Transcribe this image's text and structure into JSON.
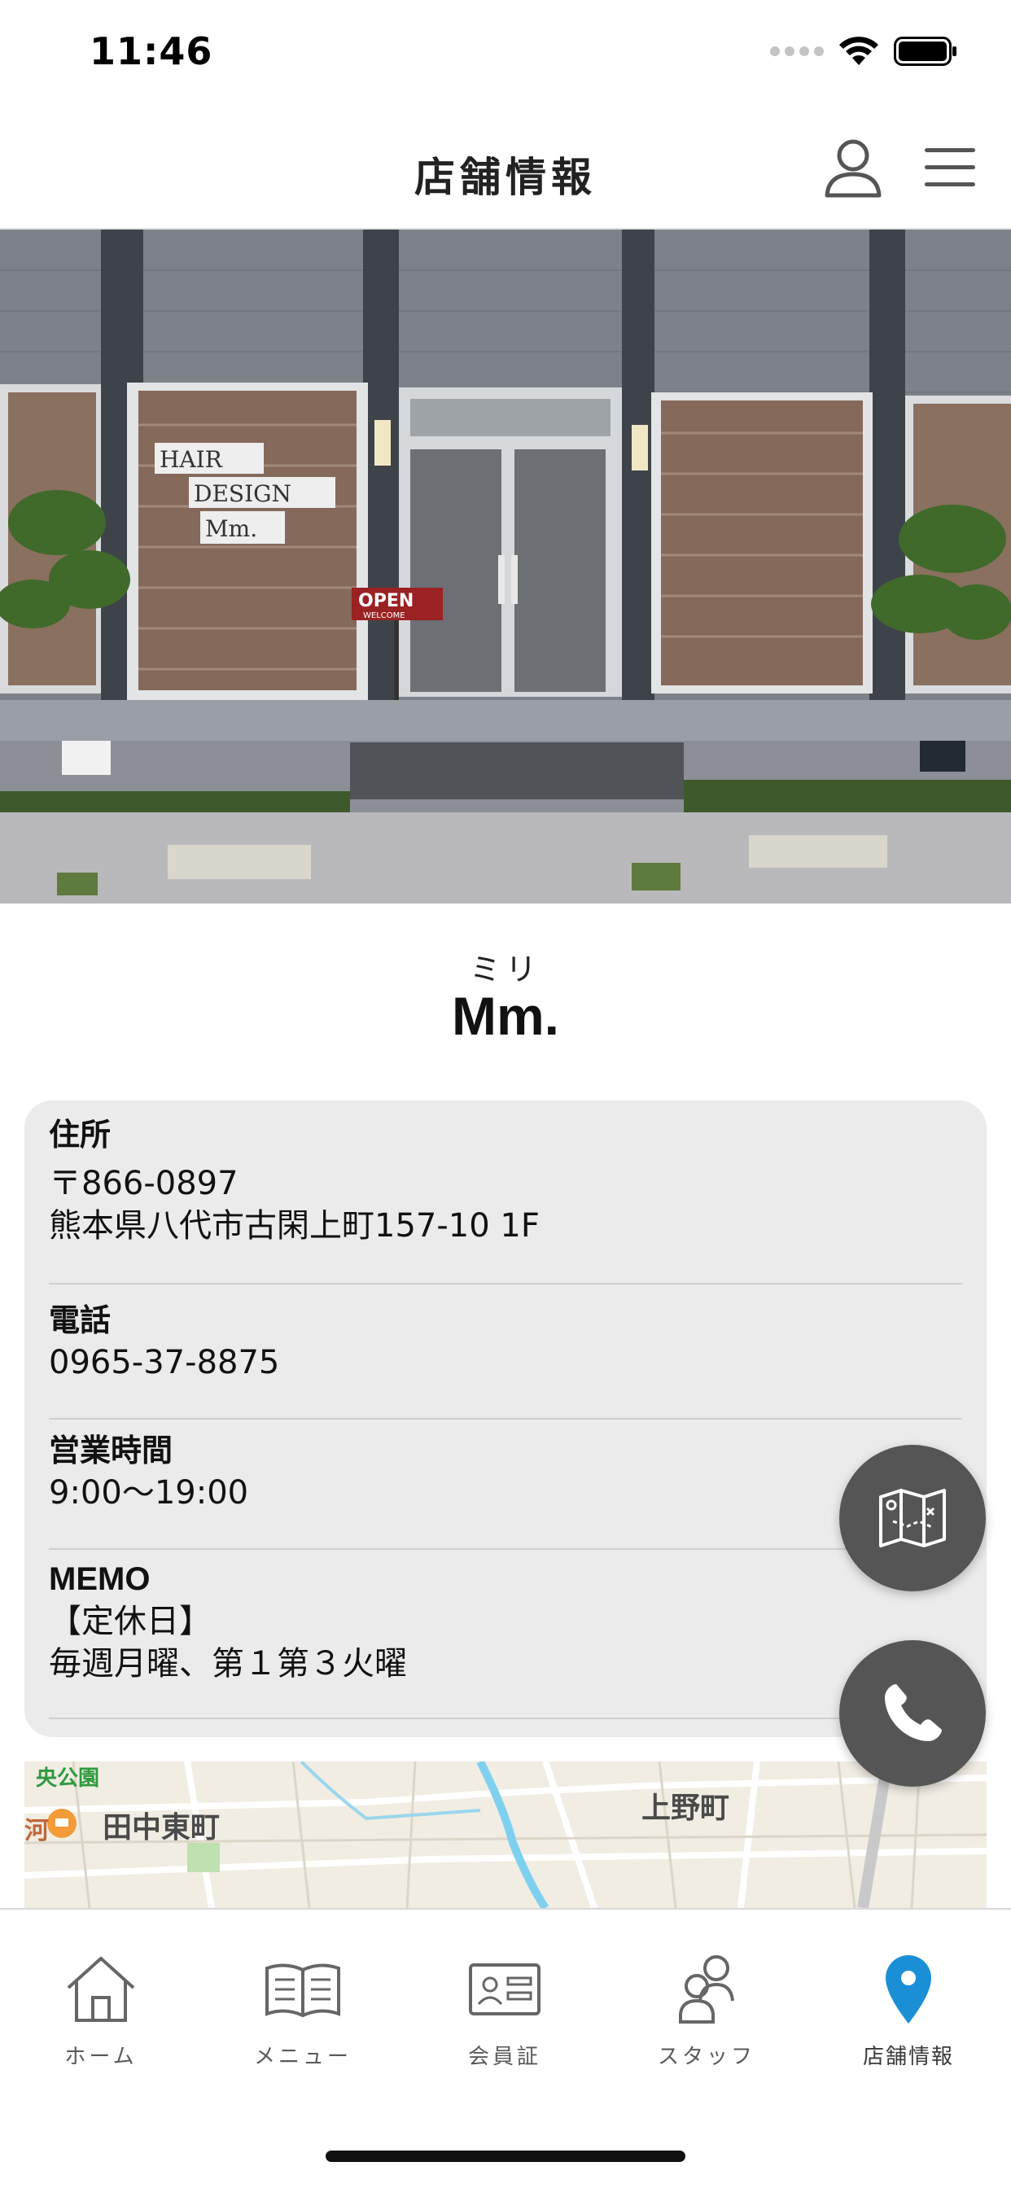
{
  "status_bar": {
    "time": "11:46"
  },
  "nav": {
    "title": "店舗情報"
  },
  "hero": {
    "window_text": [
      "HAIR",
      "DESIGN",
      "Mm."
    ],
    "sign_text": "OPEN",
    "sign_subtext": "WELCOME"
  },
  "shop": {
    "ruby": "ミリ",
    "name": "Mm."
  },
  "info": {
    "address": {
      "label": "住所",
      "postal": "〒866-0897",
      "line": "熊本県八代市古閑上町157-10 1F"
    },
    "phone": {
      "label": "電話",
      "value": "0965-37-8875"
    },
    "hours": {
      "label": "営業時間",
      "value": "9:00〜19:00"
    },
    "memo": {
      "label": "MEMO",
      "line1": "【定休日】",
      "line2": "毎週月曜、第１第３火曜"
    }
  },
  "map": {
    "park_label": "央公園",
    "edge_label": "河",
    "area_left": "田中東町",
    "area_right": "上野町"
  },
  "tabs": [
    {
      "label": "ホーム",
      "icon": "home-icon",
      "active": false
    },
    {
      "label": "メニュー",
      "icon": "book-icon",
      "active": false
    },
    {
      "label": "会員証",
      "icon": "member-card-icon",
      "active": false
    },
    {
      "label": "スタッフ",
      "icon": "staff-icon",
      "active": false
    },
    {
      "label": "店舗情報",
      "icon": "location-pin-icon",
      "active": true
    }
  ],
  "colors": {
    "accent": "#1A8FD6",
    "fab": "#555555",
    "card": "#EBEBEB"
  }
}
